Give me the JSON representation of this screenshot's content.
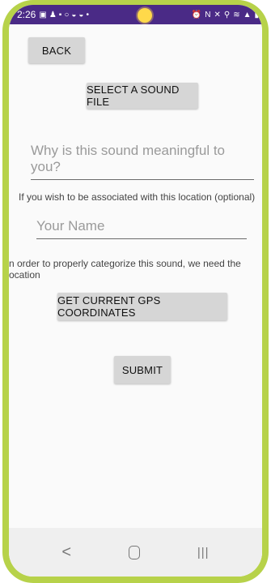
{
  "status_bar": {
    "time": "2:26"
  },
  "buttons": {
    "back": "BACK",
    "select_sound": "SELECT A SOUND FILE",
    "get_gps": "GET CURRENT GPS COORDINATES",
    "submit": "SUBMIT"
  },
  "fields": {
    "meaning_placeholder": "Why is this sound meaningful to you?",
    "name_placeholder": "Your Name"
  },
  "hints": {
    "association": "If you wish to be associated with this location (optional)",
    "location": "n order to properly categorize this sound, we need the\nocation"
  },
  "nav": {
    "back": "<",
    "recents": "|||"
  },
  "colors": {
    "frame": "#b7d24a",
    "status_bar": "#4a2a86",
    "button": "#d6d6d6"
  }
}
